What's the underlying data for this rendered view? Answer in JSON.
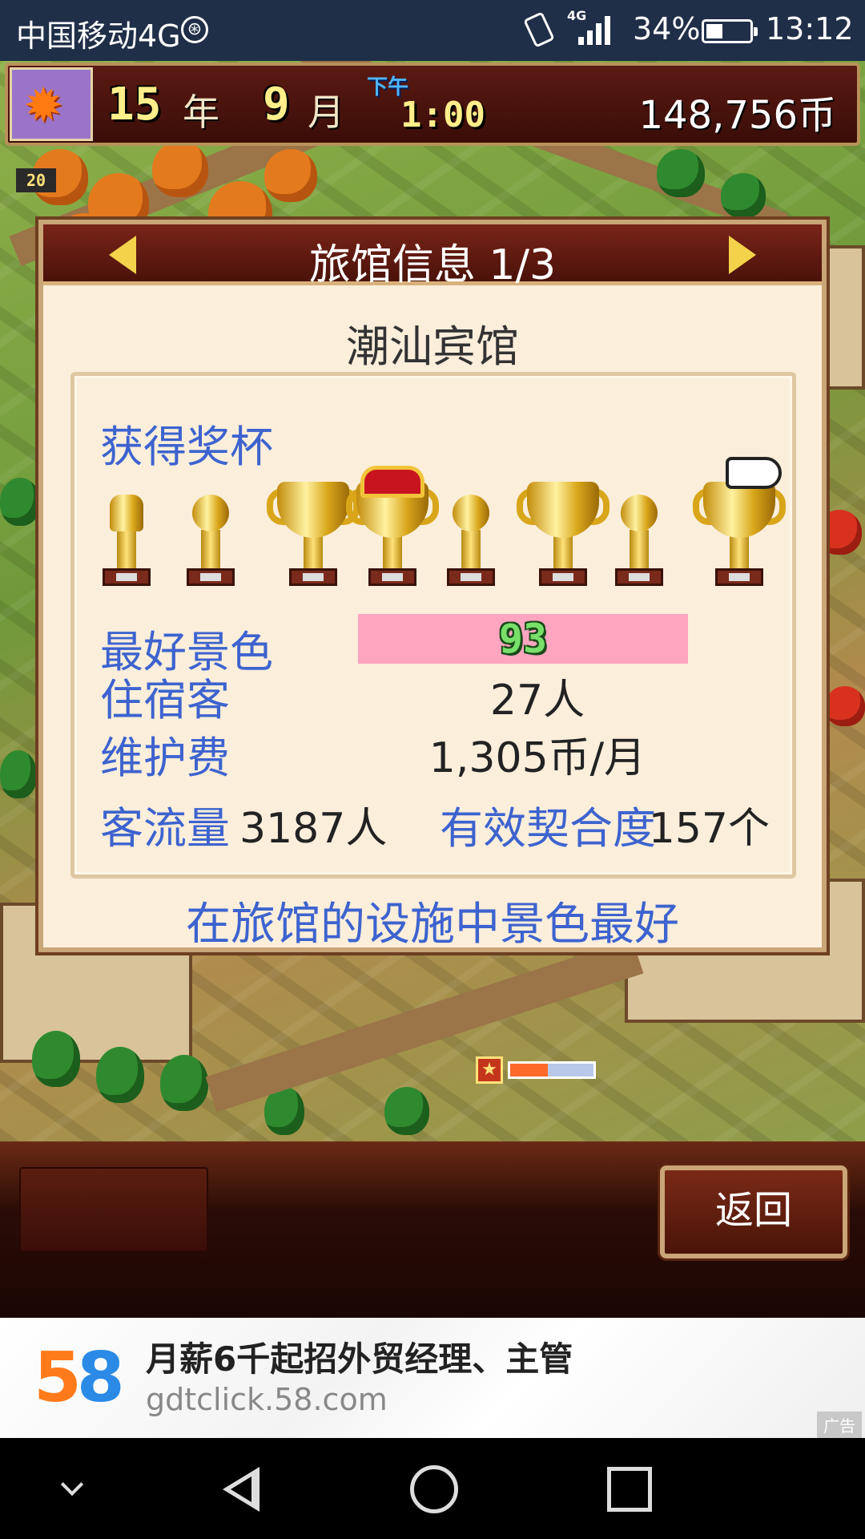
{
  "status_bar": {
    "carrier": "中国移动4G",
    "network_label": "4G",
    "battery_percent_text": "34%",
    "battery_level": 0.34,
    "time": "13:12"
  },
  "hud": {
    "year_num": "15",
    "year_unit": "年",
    "month_num": "9",
    "month_unit": "月",
    "ampm": "下午",
    "clock": "1:00",
    "money": "148,756币",
    "season_icon": "maple-leaf-icon"
  },
  "map": {
    "corner_badge": "20",
    "star_meter_fill": 0.45
  },
  "dialog": {
    "title": "旅馆信息 1/3",
    "hotel_name": "潮汕宾馆",
    "trophies_label": "获得奖杯",
    "trophies": [
      "torch",
      "knob",
      "big",
      "crown",
      "knob",
      "big",
      "knob",
      "big"
    ],
    "best_view_label": "最好景色",
    "best_view_value": "93",
    "guests_label": "住宿客",
    "guests_value": "27人",
    "upkeep_label": "维护费",
    "upkeep_value": "1,305币/月",
    "traffic_label": "客流量",
    "traffic_value": "3187人",
    "synergy_label": "有效契合度",
    "synergy_value": "157个",
    "footer": "在旅馆的设施中景色最好"
  },
  "actions": {
    "back_label": "返回"
  },
  "ad": {
    "logo_5": "5",
    "logo_8": "8",
    "headline": "月薪6千起招外贸经理、主管",
    "domain": "gdtclick.58.com",
    "tag": "广告"
  },
  "colors": {
    "label_blue": "#3d63cf",
    "best_bar_pink": "#ffa5c0",
    "title_bar": "#7a2418"
  }
}
